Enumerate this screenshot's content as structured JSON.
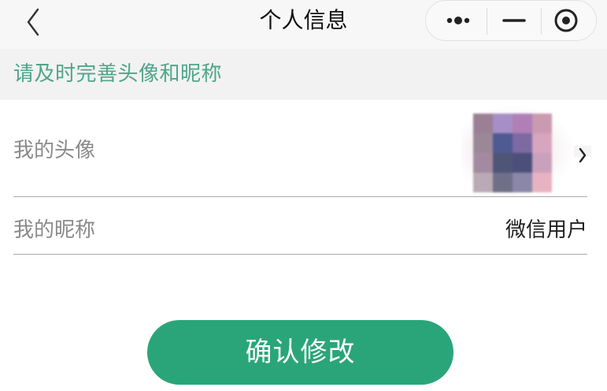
{
  "navbar": {
    "title": "个人信息",
    "back_icon": "chevron-left-icon",
    "capsule": {
      "more_icon": "more-dots-icon",
      "minimize_icon": "minimize-icon",
      "close_icon": "target-close-icon"
    }
  },
  "notice": {
    "text": "请及时完善头像和昵称",
    "color": "#4fa58a"
  },
  "profile": {
    "avatar_label": "我的头像",
    "avatar_icon": "pixelated-avatar",
    "nickname_label": "我的昵称",
    "nickname_value": "微信用户"
  },
  "actions": {
    "confirm_label": "确认修改",
    "confirm_color": "#2aa57a"
  }
}
